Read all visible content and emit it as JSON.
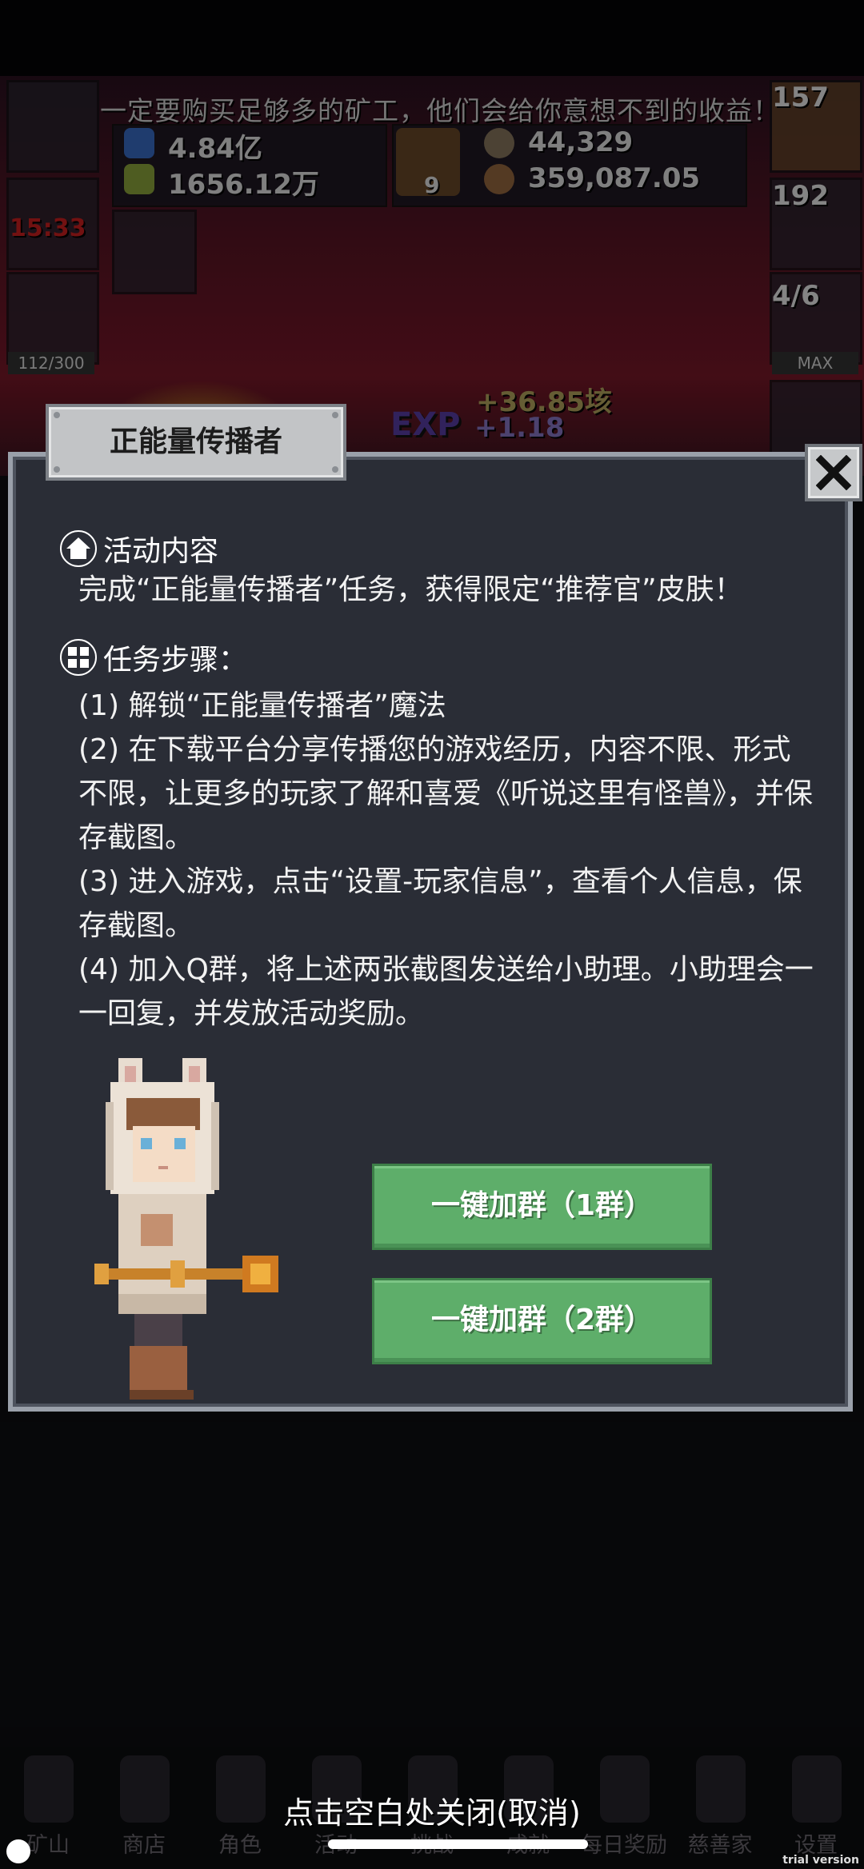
{
  "hud": {
    "tip_text": "一定要购买足够多的矿工，他们会给你意想不到的收益！",
    "resource_1": "4.84亿",
    "resource_2": "1656.12万",
    "resource_3": "44,329",
    "resource_4": "359,087.05",
    "book_count": "9",
    "potion_count": "157",
    "chest_count": "192",
    "slime_count": "4/6",
    "slime_bar": "MAX",
    "timer": "15:33",
    "capacity": "112/300",
    "gain_1": "+36.85垓",
    "gain_2": "+1.18",
    "exp_label": "EXP"
  },
  "dialog": {
    "title": "正能量传播者",
    "section1_title": "活动内容",
    "section1_body": "完成“正能量传播者”任务，获得限定“推荐官”皮肤！",
    "section2_title": "任务步骤：",
    "steps": [
      "(1) 解锁“正能量传播者”魔法",
      "(2) 在下载平台分享传播您的游戏经历，内容不限、形式不限，让更多的玩家了解和喜爱《听说这里有怪兽》，并保存截图。",
      "(3) 进入游戏，点击“设置-玩家信息”，查看个人信息，保存截图。",
      "(4) 加入Q群，将上述两张截图发送给小助理。小助理会一一回复，并发放活动奖励。"
    ],
    "button_1": "一键加群（1群）",
    "button_2": "一键加群（2群）"
  },
  "nav": {
    "items": [
      "矿山",
      "商店",
      "角色",
      "活动",
      "挑战",
      "成就",
      "每日奖励",
      "慈善家",
      "设置"
    ]
  },
  "close_hint": "点击空白处关闭(取消)",
  "watermark": "trial version",
  "colors": {
    "button_green": "#5eae6a",
    "dialog_bg": "#2a2d36",
    "dialog_border": "#9aa0aa",
    "title_plate": "#c2c4c6"
  }
}
